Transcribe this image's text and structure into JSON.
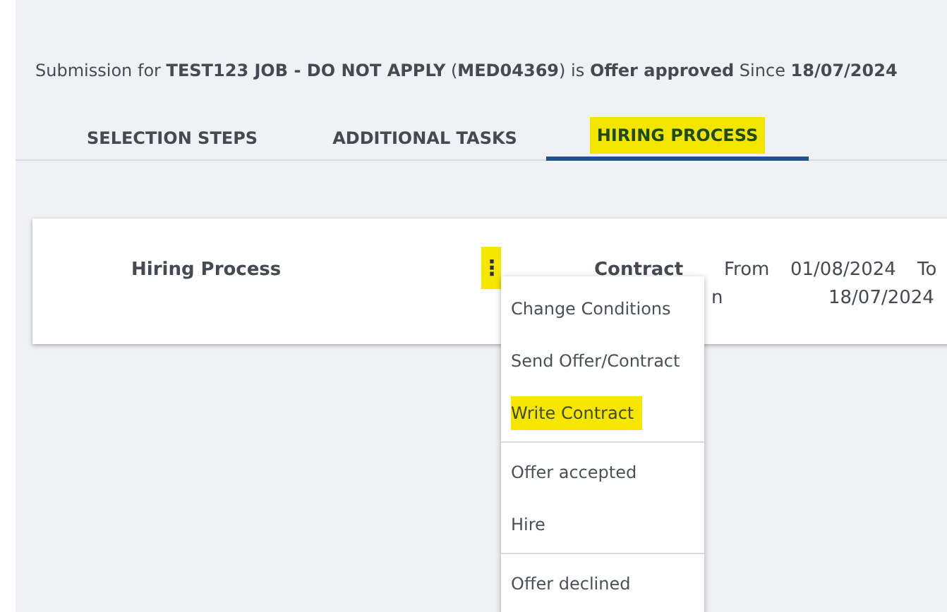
{
  "header": {
    "text": "Submission for **TEST123 JOB - DO NOT APPLY** (**MED04369**) is **Offer approved** Since **18/07/2024**"
  },
  "tabs": [
    {
      "label": "SELECTION STEPS",
      "selected": false,
      "highlighted": false
    },
    {
      "label": "ADDITIONAL TASKS",
      "selected": false,
      "highlighted": false
    },
    {
      "label": "HIRING PROCESS",
      "selected": true,
      "highlighted": true
    }
  ],
  "card": {
    "title": "Hiring Process",
    "menu_button": {
      "label": "⋮",
      "highlighted": true
    },
    "status": "Contract",
    "status_line_2": "n",
    "from_label": "From",
    "from_date": "01/08/2024",
    "to_label": "To",
    "to_date": "18/07/2024"
  },
  "menu": {
    "groups": [
      [
        {
          "label": "Change Conditions",
          "highlighted": false
        },
        {
          "label": "Send Offer/Contract",
          "highlighted": false
        },
        {
          "label": "Write Contract",
          "highlighted": true
        }
      ],
      [
        {
          "label": "Offer accepted",
          "highlighted": false
        },
        {
          "label": "Hire",
          "highlighted": false
        }
      ],
      [
        {
          "label": "Offer declined",
          "highlighted": false
        }
      ]
    ]
  }
}
